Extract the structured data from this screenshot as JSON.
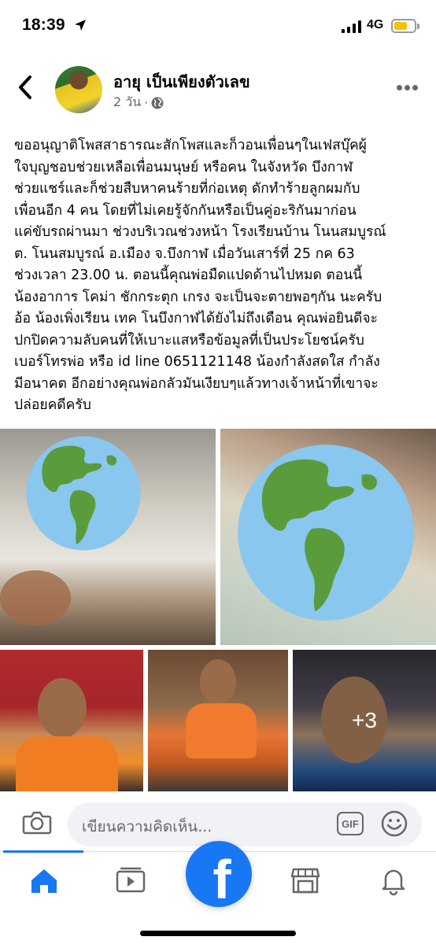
{
  "status_bar": {
    "time": "18:39",
    "network": "4G",
    "battery_color": "#f4c20d"
  },
  "post": {
    "author": "อายุ เป็นเพียงตัวเลข",
    "time_ago": "2 วัน",
    "separator": "·",
    "privacy_icon": "globe-icon",
    "text_lines": [
      "ขออนุญาติโพสสาธารณะสักโพสและก็วอนเพื่อนๆในเฟสบุ๊คผู้",
      "ใจบุญชอบช่วยเหลือเพื่อนมนุษย์ หรือคน ในจังหวัด บึงกาฬ",
      "ช่วยแชร์และก็ช่วยสืบหาคนร้ายที่ก่อเหตุ ดักทำร้ายลูกผมกับ",
      "เพื่อนอีก 4  คน โดยที่ไม่เคยรู้จักกันหรือเป็นคู่อะริกันมาก่อน",
      "แค่ขับรถผ่านมา ช่วงบริเวณช่วงหน้า โรงเรียนบ้าน โนนสมบูรณ์",
      "ต. โนนสมบูรณ์ อ.เมือง จ.บึงกาฬ   เมื่อวันเสาร์ที่ 25 กค 63",
      "ช่วงเวลา 23.00 น. ตอนนี้คุณพ่อมืดแปดด้านไปหมด ตอนนี้",
      "น้องอาการ โคม่า ชักกระตุก เกรง จะเป็นจะตายพอๆกัน นะครับ",
      "อ้อ น้องเพิ่งเรียน เทค โนบึงกาฬได้ยังไม่ถึงเดือน คุณพ่อยินดีจะ",
      "ปกปิดความลับคนที่ให้เบาะแสหรือข้อมูลที่เป็นประโยชน์ครับ",
      "เบอร์โทรพ่อ หรือ id line 0651121148 น้องกำลังสดใส กำลัง",
      "มีอนาคต อีกอย่างคุณพ่อกลัวมันเงียบๆแล้วทางเจ้าหน้าที่เขาจะ",
      "ปล่อยคดีครับ"
    ],
    "photos": {
      "more_count": "+3",
      "sticker": "earth-globe-emoji"
    }
  },
  "comment_bar": {
    "placeholder": "เขียนความคิดเห็น...",
    "gif_label": "GIF"
  },
  "tab_bar": {
    "active": "home",
    "accent": "#1877f2",
    "fab_letter": "f",
    "tabs": [
      "home-icon",
      "watch-icon",
      "facebook-logo",
      "marketplace-icon",
      "notifications-icon"
    ]
  }
}
